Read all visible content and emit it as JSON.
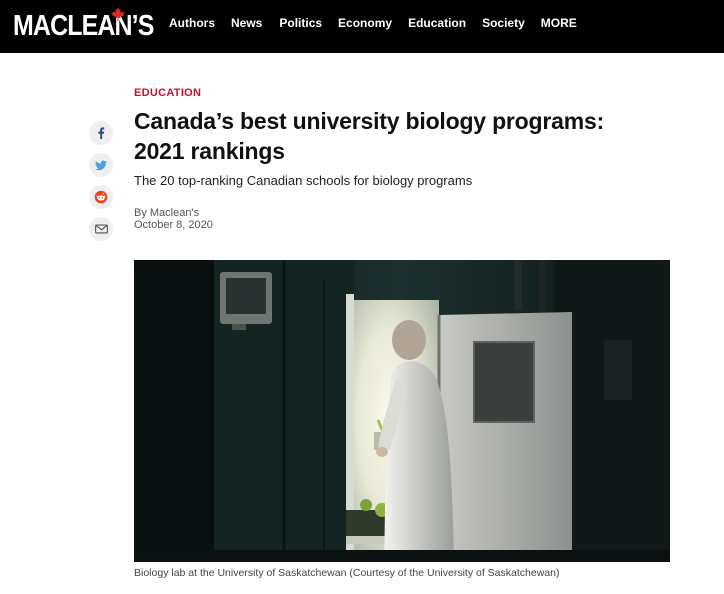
{
  "brand": {
    "name": "MACLEAN'S",
    "leaf_color": "#d62d20"
  },
  "nav": {
    "items": [
      {
        "label": "Authors"
      },
      {
        "label": "News"
      },
      {
        "label": "Politics"
      },
      {
        "label": "Economy"
      },
      {
        "label": "Education"
      },
      {
        "label": "Society"
      },
      {
        "label": "MORE"
      }
    ]
  },
  "share": {
    "icons": [
      "facebook-icon",
      "twitter-icon",
      "reddit-icon",
      "email-icon"
    ]
  },
  "article": {
    "category": "EDUCATION",
    "headline": "Canada’s best university biology programs: 2021 rankings",
    "dek": "The 20 top-ranking Canadian schools for biology programs",
    "byline": "By Maclean's",
    "date": "October 8, 2020",
    "caption": "Biology lab at the University of Saskatchewan (Courtesy of the University of Saskatchewan)"
  },
  "colors": {
    "accent": "#c8102e",
    "nav_bg": "#000000"
  }
}
